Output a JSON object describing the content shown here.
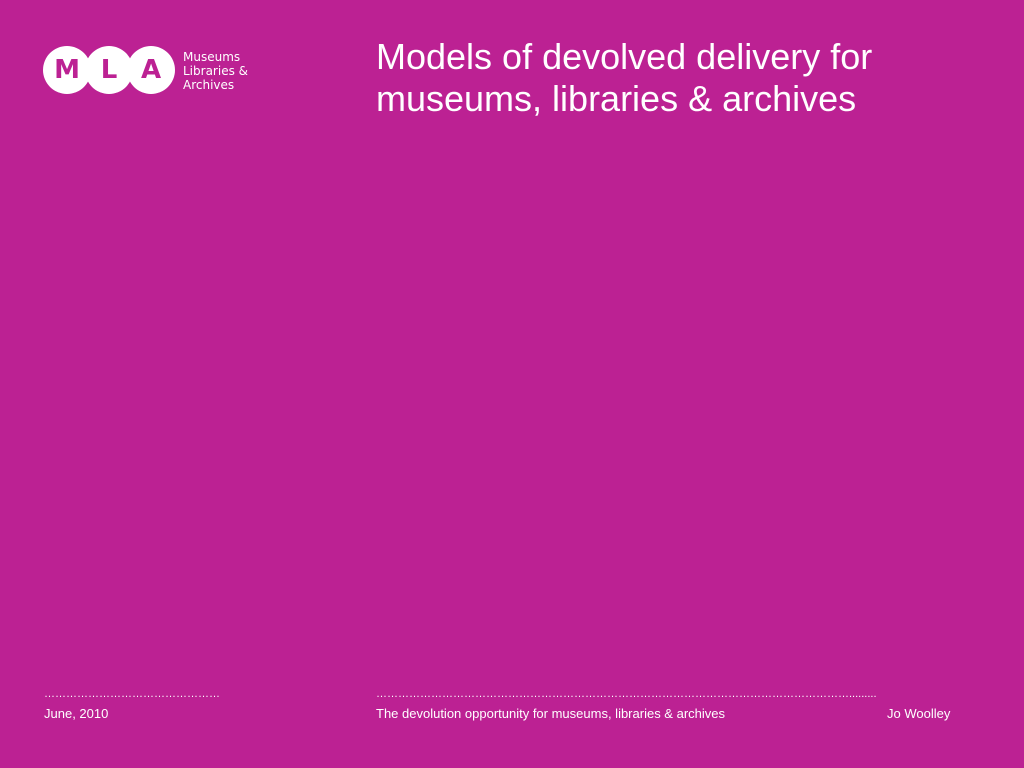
{
  "logo": {
    "letters": [
      "M",
      "L",
      "A"
    ],
    "words": [
      "Museums",
      "Libraries &",
      "Archives"
    ]
  },
  "title": {
    "line1": "Models of devolved delivery for",
    "line2": "museums, libraries & archives"
  },
  "footer": {
    "left_rule": "…………………………………………",
    "right_rule": "………………………………………………………………………………………………………………….........",
    "date": "June, 2010",
    "subject": "The devolution opportunity for museums, libraries & archives",
    "author": "Jo Woolley"
  },
  "colors": {
    "background": "#bc2193",
    "text": "#ffffff"
  }
}
